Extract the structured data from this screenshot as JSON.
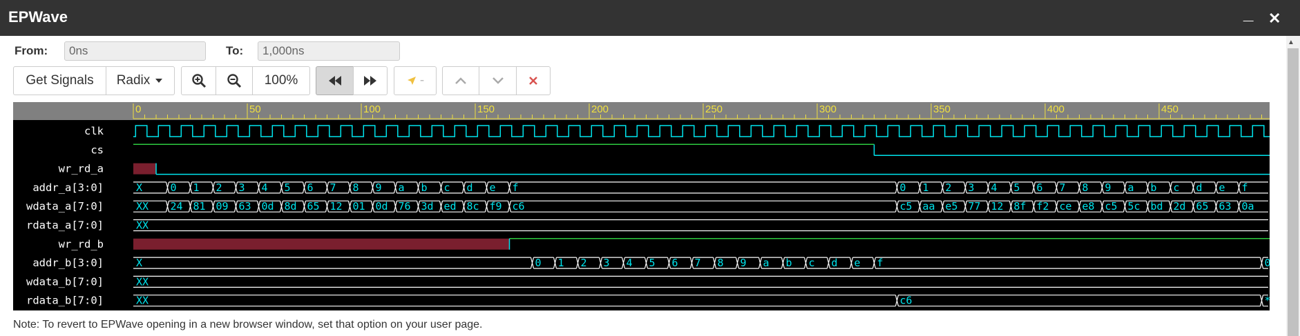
{
  "window": {
    "title": "EPWave",
    "minimize": "_",
    "close": "✕"
  },
  "range": {
    "from_label": "From:",
    "from_value": "0ns",
    "to_label": "To:",
    "to_value": "1,000ns"
  },
  "toolbar": {
    "get_signals": "Get Signals",
    "radix": "Radix",
    "zoom": "100%",
    "cursor_label": "-"
  },
  "icons": {
    "zoom_in": "zoom-in-icon",
    "zoom_out": "zoom-out-icon",
    "rewind": "fast-backward-icon",
    "forward": "fast-forward-icon",
    "marker": "marker-arrow-icon",
    "up": "chevron-up-icon",
    "down": "chevron-down-icon",
    "remove": "close-icon",
    "dropdown": "caret-down-icon"
  },
  "colors": {
    "wave": "#00e5ee",
    "ruler": "#f0e040",
    "ruler_bg": "#808080",
    "bus": "#ffffff",
    "unknown_fill": "#7a1f2e",
    "remove": "#d9534f"
  },
  "ruler": {
    "ticks": [
      "0",
      "50",
      "100",
      "150",
      "200",
      "250",
      "300",
      "350",
      "400",
      "450"
    ]
  },
  "signals": [
    {
      "name": "clk",
      "type": "clock",
      "period": 10
    },
    {
      "name": "cs",
      "type": "bit",
      "transitions": [
        [
          0,
          1
        ],
        [
          325,
          0
        ]
      ]
    },
    {
      "name": "wr_rd_a",
      "type": "bit",
      "transitions": [
        [
          0,
          "x"
        ],
        [
          10,
          0
        ]
      ]
    },
    {
      "name": "addr_a[3:0]",
      "type": "bus",
      "segments": [
        [
          0,
          "X"
        ],
        [
          15,
          "0"
        ],
        [
          25,
          "1"
        ],
        [
          35,
          "2"
        ],
        [
          45,
          "3"
        ],
        [
          55,
          "4"
        ],
        [
          65,
          "5"
        ],
        [
          75,
          "6"
        ],
        [
          85,
          "7"
        ],
        [
          95,
          "8"
        ],
        [
          105,
          "9"
        ],
        [
          115,
          "a"
        ],
        [
          125,
          "b"
        ],
        [
          135,
          "c"
        ],
        [
          145,
          "d"
        ],
        [
          155,
          "e"
        ],
        [
          165,
          "f"
        ],
        [
          335,
          "0"
        ],
        [
          345,
          "1"
        ],
        [
          355,
          "2"
        ],
        [
          365,
          "3"
        ],
        [
          375,
          "4"
        ],
        [
          385,
          "5"
        ],
        [
          395,
          "6"
        ],
        [
          405,
          "7"
        ],
        [
          415,
          "8"
        ],
        [
          425,
          "9"
        ],
        [
          435,
          "a"
        ],
        [
          445,
          "b"
        ],
        [
          455,
          "c"
        ],
        [
          465,
          "d"
        ],
        [
          475,
          "e"
        ],
        [
          485,
          "f"
        ]
      ]
    },
    {
      "name": "wdata_a[7:0]",
      "type": "bus",
      "segments": [
        [
          0,
          "XX"
        ],
        [
          15,
          "24"
        ],
        [
          25,
          "81"
        ],
        [
          35,
          "09"
        ],
        [
          45,
          "63"
        ],
        [
          55,
          "0d"
        ],
        [
          65,
          "8d"
        ],
        [
          75,
          "65"
        ],
        [
          85,
          "12"
        ],
        [
          95,
          "01"
        ],
        [
          105,
          "0d"
        ],
        [
          115,
          "76"
        ],
        [
          125,
          "3d"
        ],
        [
          135,
          "ed"
        ],
        [
          145,
          "8c"
        ],
        [
          155,
          "f9"
        ],
        [
          165,
          "c6"
        ],
        [
          335,
          "c5"
        ],
        [
          345,
          "aa"
        ],
        [
          355,
          "e5"
        ],
        [
          365,
          "77"
        ],
        [
          375,
          "12"
        ],
        [
          385,
          "8f"
        ],
        [
          395,
          "f2"
        ],
        [
          405,
          "ce"
        ],
        [
          415,
          "e8"
        ],
        [
          425,
          "c5"
        ],
        [
          435,
          "5c"
        ],
        [
          445,
          "bd"
        ],
        [
          455,
          "2d"
        ],
        [
          465,
          "65"
        ],
        [
          475,
          "63"
        ],
        [
          485,
          "0a"
        ]
      ]
    },
    {
      "name": "rdata_a[7:0]",
      "type": "bus",
      "segments": [
        [
          0,
          "XX"
        ]
      ]
    },
    {
      "name": "wr_rd_b",
      "type": "bit",
      "transitions": [
        [
          0,
          "x"
        ],
        [
          165,
          1
        ]
      ]
    },
    {
      "name": "addr_b[3:0]",
      "type": "bus",
      "segments": [
        [
          0,
          "X"
        ],
        [
          175,
          "0"
        ],
        [
          185,
          "1"
        ],
        [
          195,
          "2"
        ],
        [
          205,
          "3"
        ],
        [
          215,
          "4"
        ],
        [
          225,
          "5"
        ],
        [
          235,
          "6"
        ],
        [
          245,
          "7"
        ],
        [
          255,
          "8"
        ],
        [
          265,
          "9"
        ],
        [
          275,
          "a"
        ],
        [
          285,
          "b"
        ],
        [
          295,
          "c"
        ],
        [
          305,
          "d"
        ],
        [
          315,
          "e"
        ],
        [
          325,
          "f"
        ],
        [
          495,
          "0"
        ]
      ]
    },
    {
      "name": "wdata_b[7:0]",
      "type": "bus",
      "segments": [
        [
          0,
          "XX"
        ]
      ]
    },
    {
      "name": "rdata_b[7:0]",
      "type": "bus",
      "segments": [
        [
          0,
          "XX"
        ],
        [
          335,
          "c6"
        ],
        [
          495,
          "*"
        ]
      ]
    }
  ],
  "note": "Note: To revert to EPWave opening in a new browser window, set that option on your user page."
}
